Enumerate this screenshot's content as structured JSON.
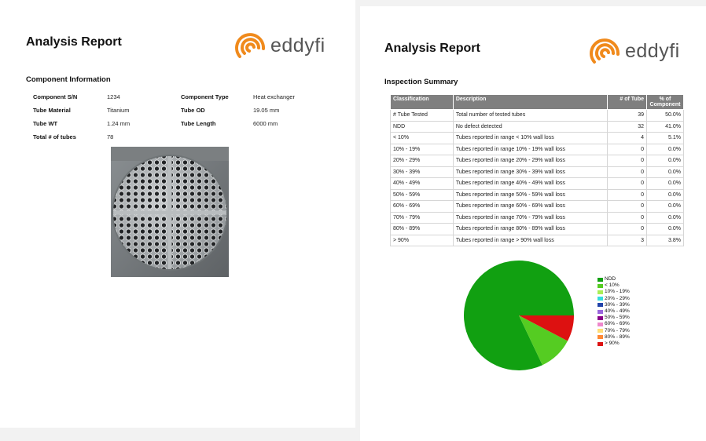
{
  "left_page": {
    "title": "Analysis Report",
    "logo_text": "eddyfi",
    "section_title": "Component Information",
    "fields": [
      {
        "label": "Component S/N",
        "value": "1234"
      },
      {
        "label": "Tube Material",
        "value": "Titanium"
      },
      {
        "label": "Tube WT",
        "value": "1.24 mm"
      },
      {
        "label": "Total # of tubes",
        "value": "78"
      },
      {
        "label": "Component Type",
        "value": "Heat exchanger"
      },
      {
        "label": "Tube OD",
        "value": "19.05 mm"
      },
      {
        "label": "Tube Length",
        "value": "6000 mm"
      }
    ]
  },
  "right_page": {
    "title": "Analysis Report",
    "logo_text": "eddyfi",
    "section_title": "Inspection Summary",
    "table": {
      "headers": [
        "Classification",
        "Description",
        "# of Tube",
        "% of Component"
      ],
      "rows": [
        [
          "# Tube Tested",
          "Total number of tested tubes",
          "39",
          "50.0%"
        ],
        [
          "NDD",
          "No defect detected",
          "32",
          "41.0%"
        ],
        [
          "< 10%",
          "Tubes reported in range < 10% wall loss",
          "4",
          "5.1%"
        ],
        [
          "10% - 19%",
          "Tubes reported in range 10% - 19% wall loss",
          "0",
          "0.0%"
        ],
        [
          "20% - 29%",
          "Tubes reported in range 20% - 29% wall loss",
          "0",
          "0.0%"
        ],
        [
          "30% - 39%",
          "Tubes reported in range 30% - 39% wall loss",
          "0",
          "0.0%"
        ],
        [
          "40% - 49%",
          "Tubes reported in range 40% - 49% wall loss",
          "0",
          "0.0%"
        ],
        [
          "50% - 59%",
          "Tubes reported in range 50% - 59% wall loss",
          "0",
          "0.0%"
        ],
        [
          "60% - 69%",
          "Tubes reported in range 60% - 69% wall loss",
          "0",
          "0.0%"
        ],
        [
          "70% - 79%",
          "Tubes reported in range 70% - 79% wall loss",
          "0",
          "0.0%"
        ],
        [
          "80% - 89%",
          "Tubes reported in range 80% - 89% wall loss",
          "0",
          "0.0%"
        ],
        [
          "> 90%",
          "Tubes reported in range > 90% wall loss",
          "3",
          "3.8%"
        ]
      ]
    }
  },
  "colors": {
    "logo_orange": "#f08a1c",
    "table_header": "#7f7f7f"
  },
  "icons": [
    "eddyfi-logo-icon"
  ],
  "chart_data": {
    "type": "pie",
    "categories": [
      "NDD",
      "< 10%",
      "10% - 19%",
      "20% - 29%",
      "30% - 39%",
      "40% - 49%",
      "50% - 59%",
      "60% - 69%",
      "70% - 79%",
      "80% - 89%",
      "> 90%"
    ],
    "values": [
      32,
      4,
      0,
      0,
      0,
      0,
      0,
      0,
      0,
      0,
      3
    ],
    "colors": [
      "#11a011",
      "#55cc22",
      "#aaee55",
      "#33dddd",
      "#2244aa",
      "#9966dd",
      "#880088",
      "#ee88cc",
      "#ffdd77",
      "#ff8833",
      "#dd1111"
    ],
    "legend": "right"
  }
}
